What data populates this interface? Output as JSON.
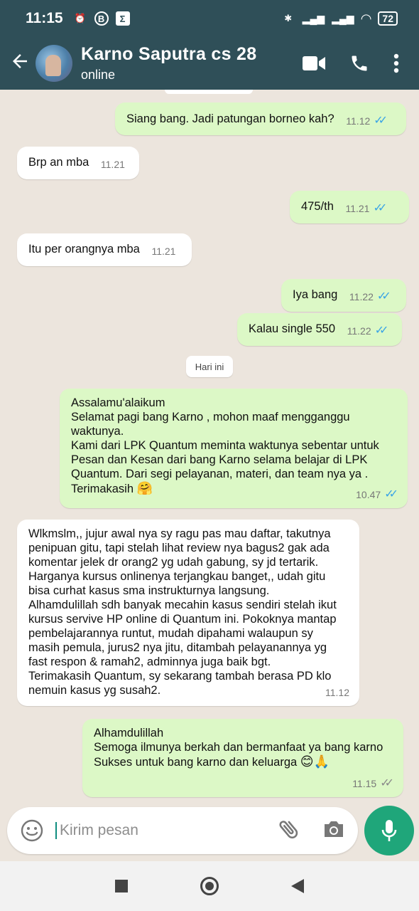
{
  "status_bar": {
    "time": "11:15",
    "battery": "72"
  },
  "header": {
    "contact_name": "Karno Saputra cs 28",
    "contact_status": "online"
  },
  "chat": {
    "date_separator": "Hari ini",
    "messages": [
      {
        "direction": "out",
        "text": "Siang bang. Jadi patungan borneo kah?",
        "time": "11.12",
        "ticks": "read"
      },
      {
        "direction": "in",
        "text": "Brp an mba",
        "time": "11.21"
      },
      {
        "direction": "out",
        "text": "475/th",
        "time": "11.21",
        "ticks": "read"
      },
      {
        "direction": "in",
        "text": "Itu per orangnya mba",
        "time": "11.21"
      },
      {
        "direction": "out",
        "text": "Iya bang",
        "time": "11.22",
        "ticks": "read"
      },
      {
        "direction": "out",
        "text": "Kalau single 550",
        "time": "11.22",
        "ticks": "read"
      },
      {
        "direction": "out",
        "text": "Assalamu'alaikum\nSelamat pagi bang Karno , mohon maaf mengganggu\nwaktunya.\nKami dari LPK Quantum meminta waktunya sebentar untuk\nPesan dan Kesan dari bang Karno selama belajar di LPK\nQuantum. Dari segi pelayanan, materi, dan team nya ya .\nTerimakasih",
        "emoji": "🤗",
        "time": "10.47",
        "ticks": "read"
      },
      {
        "direction": "in",
        "text": "Wlkmslm,, jujur awal nya sy ragu pas mau daftar, takutnya\npenipuan gitu, tapi stelah lihat review nya bagus2 gak ada\nkomentar jelek dr orang2 yg udah gabung, sy jd tertarik.\nHarganya kursus onlinenya terjangkau banget,, udah gitu\nbisa curhat kasus sma instrukturnya langsung.\nAlhamdulillah sdh banyak mecahin kasus sendiri stelah ikut\nkursus servive HP online di Quantum ini. Pokoknya mantap\npembelajarannya runtut, mudah dipahami walaupun sy\nmasih pemula, jurus2 nya jitu, ditambah pelayanannya yg\nfast respon & ramah2, adminnya juga baik bgt.\nTerimakasih Quantum, sy sekarang tambah berasa PD klo\nnemuin kasus yg susah2.",
        "time": "11.12"
      },
      {
        "direction": "out",
        "text": "Alhamdulillah\nSemoga ilmunya berkah dan bermanfaat ya bang karno\nSukses untuk bang karno dan keluarga",
        "emoji": "😊🙏",
        "time": "11.15",
        "ticks": "sent"
      }
    ]
  },
  "composer": {
    "placeholder": "Kirim pesan"
  },
  "icons": {
    "back": "arrow-left-icon",
    "video": "video-call-icon",
    "call": "phone-icon",
    "menu": "more-vert-icon",
    "emoji": "emoji-icon",
    "attach": "paperclip-icon",
    "camera": "camera-icon",
    "mic": "mic-icon"
  },
  "colors": {
    "header_bg": "#2f4f58",
    "outgoing_bubble": "#dcf8c6",
    "incoming_bubble": "#ffffff",
    "read_ticks": "#3aa4e6",
    "mic_button": "#1fa67a"
  }
}
